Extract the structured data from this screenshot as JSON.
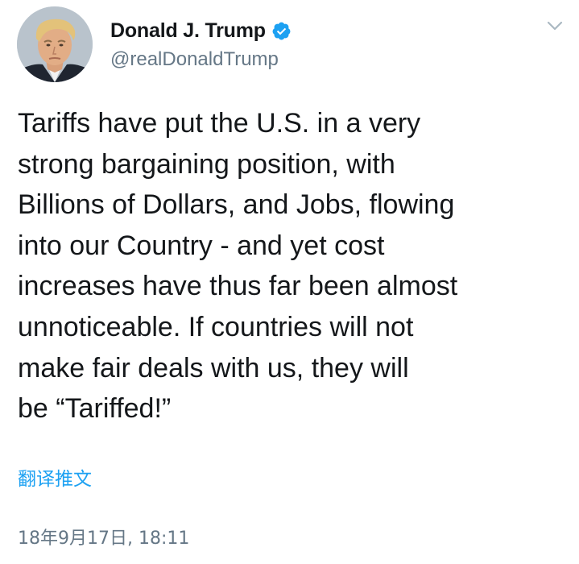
{
  "author": {
    "display_name": "Donald J. Trump",
    "handle": "@realDonaldTrump",
    "verified": true,
    "verified_color": "#1da1f2"
  },
  "tweet": {
    "text_lines": [
      "Tariffs have put the U.S. in a very",
      "strong bargaining position, with",
      "Billions of Dollars, and Jobs, flowing",
      "into our Country - and yet cost",
      "increases have thus far been almost",
      "unnoticeable. If countries will not",
      "make fair deals with us, they will",
      "be “Tariffed!”"
    ],
    "translate_label": "翻译推文",
    "timestamp": "18年9月17日, 18:11"
  },
  "icons": {
    "avatar": "profile-photo",
    "verified": "verified-badge-icon",
    "menu": "chevron-down-icon"
  },
  "colors": {
    "link": "#1da1f2",
    "secondary_text": "#657786",
    "primary_text": "#14171a"
  }
}
